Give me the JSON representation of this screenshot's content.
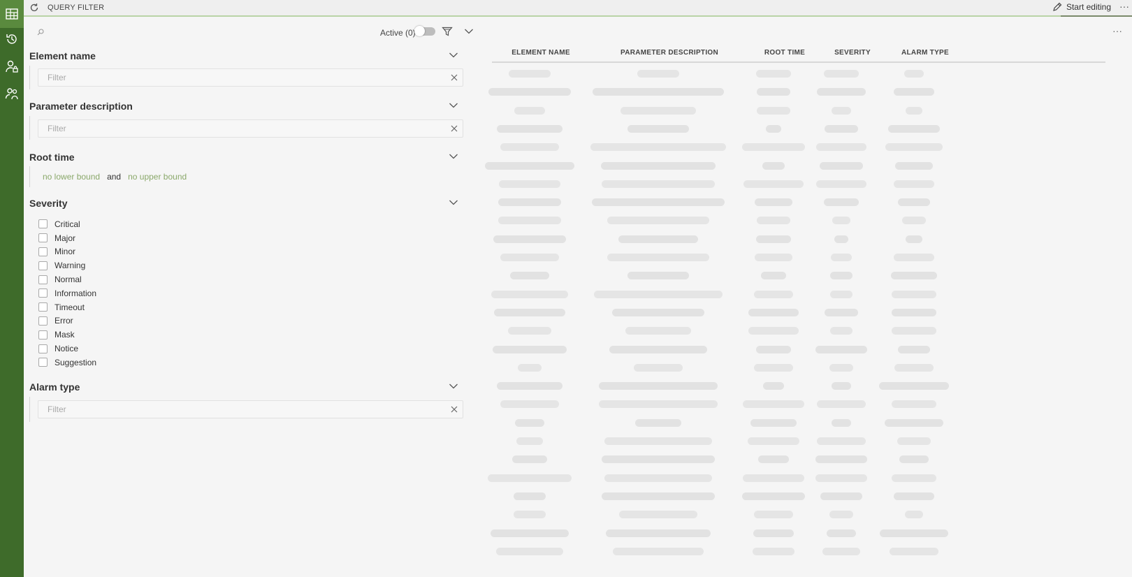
{
  "app": {
    "title": "QUERY FILTER",
    "edit_label": "Start editing",
    "more_label": "···"
  },
  "rail": {
    "items": [
      {
        "name": "table-grid-icon",
        "active": true
      },
      {
        "name": "history-icon",
        "active": false
      },
      {
        "name": "user-lock-icon",
        "active": false
      },
      {
        "name": "user-group-icon",
        "active": false
      }
    ]
  },
  "filter": {
    "active_label": "Active (0)",
    "sections": {
      "element_name": {
        "title": "Element name",
        "placeholder": "Filter"
      },
      "parameter_description": {
        "title": "Parameter description",
        "placeholder": "Filter"
      },
      "root_time": {
        "title": "Root time",
        "lower": "no lower bound",
        "and": "and",
        "upper": "no upper bound"
      },
      "severity": {
        "title": "Severity",
        "options": [
          "Critical",
          "Major",
          "Minor",
          "Warning",
          "Normal",
          "Information",
          "Timeout",
          "Error",
          "Mask",
          "Notice",
          "Suggestion"
        ]
      },
      "alarm_type": {
        "title": "Alarm type",
        "placeholder": "Filter"
      }
    }
  },
  "table": {
    "more_label": "···",
    "columns": [
      "ELEMENT NAME",
      "PARAMETER DESCRIPTION",
      "ROOT TIME",
      "SEVERITY",
      "ALARM TYPE"
    ]
  },
  "colors": {
    "rail": "#3e6b2a",
    "rail_active": "#5a8a3e",
    "accent_link": "#8aa86a",
    "skeleton": "#e5e5e5"
  }
}
